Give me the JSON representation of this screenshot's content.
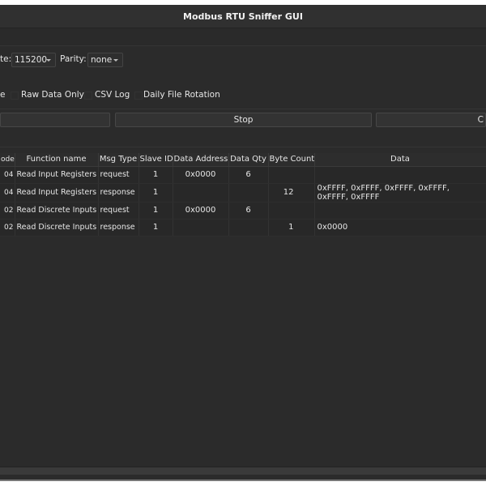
{
  "window": {
    "title": "Modbus RTU Sniffer GUI"
  },
  "settings": {
    "baud_label": "te:",
    "baud_value": "115200",
    "parity_label": "Parity:",
    "parity_value": "none"
  },
  "options": {
    "partial_label": "e",
    "raw_data_only": "Raw Data Only",
    "csv_log": "CSV Log",
    "daily_rotation": "Daily File Rotation"
  },
  "buttons": {
    "stop": "Stop",
    "right_partial": "C"
  },
  "table": {
    "headers": [
      "ode",
      "Function name",
      "Msg Type",
      "Slave ID",
      "Data Address",
      "Data Qty",
      "Byte Count",
      "Data"
    ],
    "rows": [
      [
        "04",
        "Read Input Registers",
        "request",
        "1",
        "0x0000",
        "6",
        "",
        ""
      ],
      [
        "04",
        "Read Input Registers",
        "response",
        "1",
        "",
        "",
        "12",
        "0xFFFF, 0xFFFF, 0xFFFF, 0xFFFF, 0xFFFF, 0xFFFF"
      ],
      [
        "02",
        "Read Discrete Inputs",
        "request",
        "1",
        "0x0000",
        "6",
        "",
        ""
      ],
      [
        "02",
        "Read Discrete Inputs",
        "response",
        "1",
        "",
        "",
        "1",
        "0x0000"
      ]
    ]
  }
}
